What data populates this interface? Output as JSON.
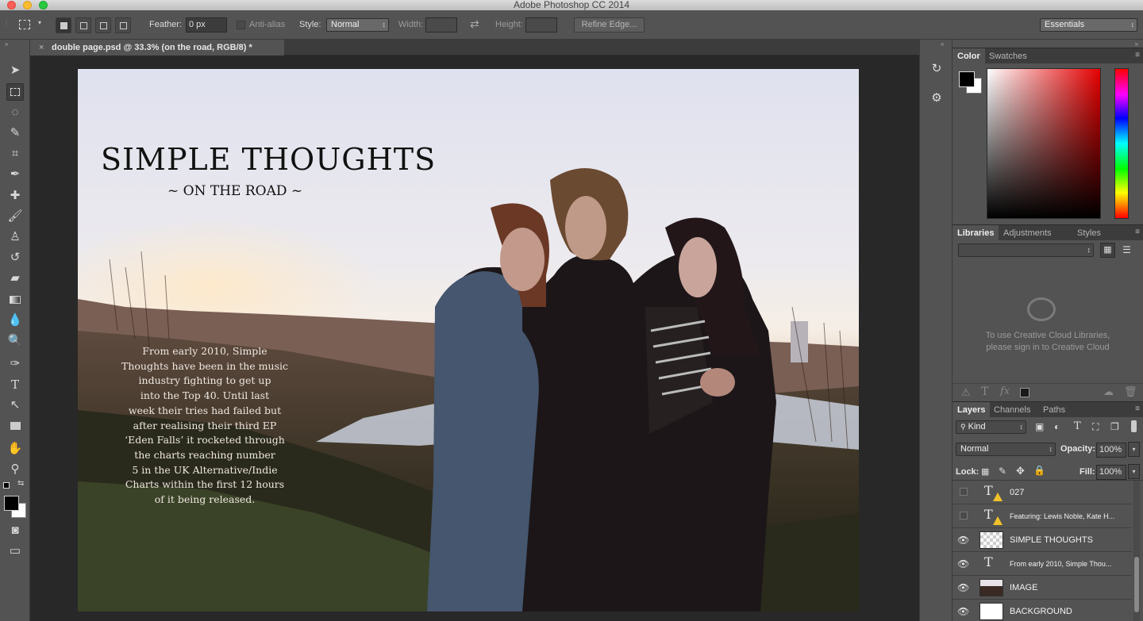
{
  "app": {
    "title": "Adobe Photoshop CC 2014"
  },
  "options": {
    "feather_label": "Feather:",
    "feather_value": "0 px",
    "antialias_label": "Anti-alias",
    "style_label": "Style:",
    "style_value": "Normal",
    "width_label": "Width:",
    "height_label": "Height:",
    "refine_edge": "Refine Edge...",
    "workspace": "Essentials"
  },
  "document": {
    "tab_title": "double page.psd @ 33.3% (on the road, RGB/8) *",
    "headline": "SIMPLE THOUGHTS",
    "subhead": "~ ON THE ROAD ~",
    "body_lines": [
      "From early 2010, Simple",
      "Thoughts have been in the music",
      "industry fighting to get up",
      "into the Top 40. Until last",
      "week their tries had failed but",
      "after realising their third EP",
      "‘Eden Falls’ it rocketed through",
      "the charts reaching number",
      "5  in the UK Alternative/Indie",
      "Charts within the first 12 hours",
      "of it being released."
    ]
  },
  "color_panel": {
    "tabs": [
      "Color",
      "Swatches"
    ]
  },
  "libraries_panel": {
    "tabs": [
      "Libraries",
      "Adjustments",
      "Styles"
    ],
    "message_line1": "To use Creative Cloud Libraries,",
    "message_line2": "please sign in to Creative Cloud"
  },
  "layers_panel": {
    "tabs": [
      "Layers",
      "Channels",
      "Paths"
    ],
    "filter": "Kind",
    "blend_mode": "Normal",
    "opacity_label": "Opacity:",
    "opacity_value": "100%",
    "lock_label": "Lock:",
    "fill_label": "Fill:",
    "fill_value": "100%",
    "layers": [
      {
        "name": "027",
        "visible": false,
        "kind": "text-warning"
      },
      {
        "name": "Featuring: Lewis Noble, Kate H...",
        "visible": false,
        "kind": "text-warning"
      },
      {
        "name": "SIMPLE THOUGHTS",
        "visible": true,
        "kind": "transparent"
      },
      {
        "name": "From early 2010, Simple  Thou...",
        "visible": true,
        "kind": "text"
      },
      {
        "name": "IMAGE",
        "visible": true,
        "kind": "image"
      },
      {
        "name": "BACKGROUND",
        "visible": true,
        "kind": "white"
      }
    ]
  },
  "colors": {
    "panel_bg": "#535353",
    "canvas_bg": "#282828",
    "foreground": "#000000",
    "background": "#ffffff",
    "warning": "#f1c12a"
  }
}
